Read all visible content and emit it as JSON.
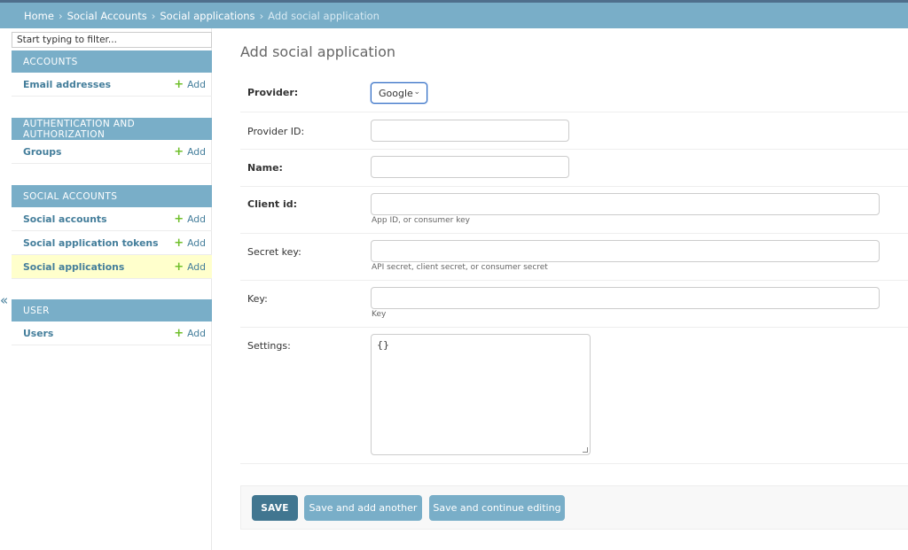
{
  "breadcrumbs": {
    "home": "Home",
    "separator": "›",
    "app": "Social Accounts",
    "model": "Social applications",
    "current": "Add social application"
  },
  "sidebar": {
    "filter_placeholder": "Start typing to filter...",
    "collapse_glyph": "«",
    "add_label": "Add",
    "modules": [
      {
        "caption": "ACCOUNTS",
        "items": [
          {
            "label": "Email addresses"
          }
        ]
      },
      {
        "caption": "AUTHENTICATION AND AUTHORIZATION",
        "items": [
          {
            "label": "Groups"
          }
        ]
      },
      {
        "caption": "SOCIAL ACCOUNTS",
        "items": [
          {
            "label": "Social accounts"
          },
          {
            "label": "Social application tokens"
          },
          {
            "label": "Social applications",
            "active": true
          }
        ]
      },
      {
        "caption": "USER",
        "items": [
          {
            "label": "Users"
          }
        ]
      }
    ]
  },
  "main": {
    "title": "Add social application",
    "fields": {
      "provider": {
        "label": "Provider:",
        "value": "Google"
      },
      "provider_id": {
        "label": "Provider ID:",
        "value": ""
      },
      "name": {
        "label": "Name:",
        "value": ""
      },
      "client_id": {
        "label": "Client id:",
        "value": "",
        "help": "App ID, or consumer key"
      },
      "secret": {
        "label": "Secret key:",
        "value": "",
        "help": "API secret, client secret, or consumer secret"
      },
      "key": {
        "label": "Key:",
        "value": "",
        "help": "Key"
      },
      "settings": {
        "label": "Settings:",
        "value": "{}"
      }
    },
    "buttons": {
      "save": "SAVE",
      "save_add_another": "Save and add another",
      "save_continue": "Save and continue editing"
    }
  },
  "colors": {
    "header": "#79aec8",
    "link": "#447e9b",
    "add_plus": "#70bf2b",
    "active_row": "#ffffcc",
    "primary_button": "#417690"
  }
}
